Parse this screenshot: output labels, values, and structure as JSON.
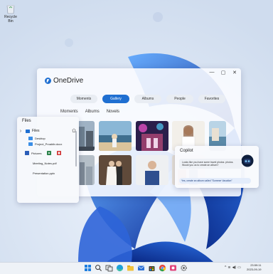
{
  "desktop": {
    "icons": [
      {
        "label": "Recycle Bin"
      }
    ]
  },
  "onedrive": {
    "title": "OneDrive",
    "window_controls": {
      "minimize": "—",
      "maximize": "▢",
      "close": "✕"
    },
    "tabs": [
      {
        "label": "Moments"
      },
      {
        "label": "Gallery",
        "active": true
      },
      {
        "label": "Albums"
      },
      {
        "label": "People"
      },
      {
        "label": "Favorites"
      }
    ],
    "subtabs": [
      {
        "label": "Moments"
      },
      {
        "label": "Albums"
      },
      {
        "label": "Novels"
      }
    ]
  },
  "files": {
    "title": "Files",
    "items": [
      {
        "label": "Files"
      },
      {
        "label": "Desktop"
      },
      {
        "label": "Project_Proaktiv.docx"
      },
      {
        "label": "Pictures"
      },
      {
        "label": "Meeting_Notes.pdf"
      },
      {
        "label": "Presentation.pptx"
      }
    ]
  },
  "copilot": {
    "title": "Copilot",
    "message": "Looks like you have some travel photos. photos. Would you us to create an album?",
    "reply": "Yes, create an album called \"Summer Vacation\""
  },
  "taskbar": {
    "icons": [
      "windows-start-icon",
      "search-icon",
      "task-view-icon",
      "edge-browser-icon",
      "file-explorer-icon",
      "mail-icon",
      "store-icon",
      "chrome-icon",
      "photos-icon",
      "settings-icon"
    ],
    "tray": {
      "chevron": "^",
      "wifi": "≋",
      "volume": "◀)",
      "battery": "▭"
    },
    "time": "23:59:11",
    "date": "2023-09-19"
  },
  "colors": {
    "accent": "#1f6fd1",
    "bloom_dark": "#0b2d9c",
    "bloom_light": "#3c8ef0",
    "excel_green": "#1b7a3e",
    "pdf_red": "#d23b3b"
  }
}
